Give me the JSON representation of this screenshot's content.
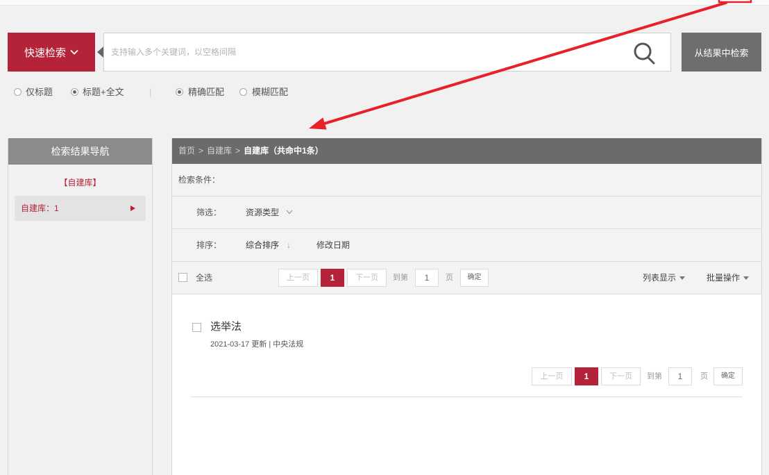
{
  "colors": {
    "accent": "#b5233a",
    "nav_header": "#8b8b8b",
    "panel_header": "#6b6b6b",
    "annotation": "#e62129"
  },
  "search": {
    "quick_label": "快速检索",
    "quick_icon": "chevron-down-icon",
    "placeholder": "支持输入多个关键词，以空格间隔",
    "value": "",
    "search_icon": "search-icon",
    "within_results_label": "从结果中检索"
  },
  "options": {
    "scope": [
      {
        "label": "仅标题",
        "selected": false
      },
      {
        "label": "标题+全文",
        "selected": true
      }
    ],
    "separator": "|",
    "match": [
      {
        "label": "精确匹配",
        "selected": true
      },
      {
        "label": "模糊匹配",
        "selected": false
      }
    ]
  },
  "sidebar": {
    "title": "检索结果导航",
    "group": "【自建库】",
    "items": [
      {
        "label": "自建库：1",
        "icon": "triangle-right-icon",
        "active": true
      }
    ]
  },
  "main": {
    "breadcrumb": {
      "home": "首页",
      "separator": ">",
      "library": "自建库",
      "current": "自建库（共命中1条）"
    },
    "conditions_label": "检索条件：",
    "filter": {
      "label": "筛选：",
      "value": "资源类型",
      "icon": "chevron-down-icon"
    },
    "sort": {
      "label": "排序：",
      "options": [
        {
          "label": "综合排序",
          "arrow": "↓",
          "active": true
        },
        {
          "label": "修改日期",
          "active": false
        }
      ]
    },
    "toolbar": {
      "select_all": "全选",
      "view_mode": "列表显示",
      "batch": "批量操作"
    },
    "pagination": {
      "prev": "上一页",
      "current": "1",
      "next": "下一页",
      "goto_prefix": "到第",
      "page_input": "1",
      "goto_suffix": "页",
      "confirm": "确定"
    },
    "results": [
      {
        "title": "选举法",
        "meta": "2021-03-17 更新 | 中央法规"
      }
    ]
  }
}
